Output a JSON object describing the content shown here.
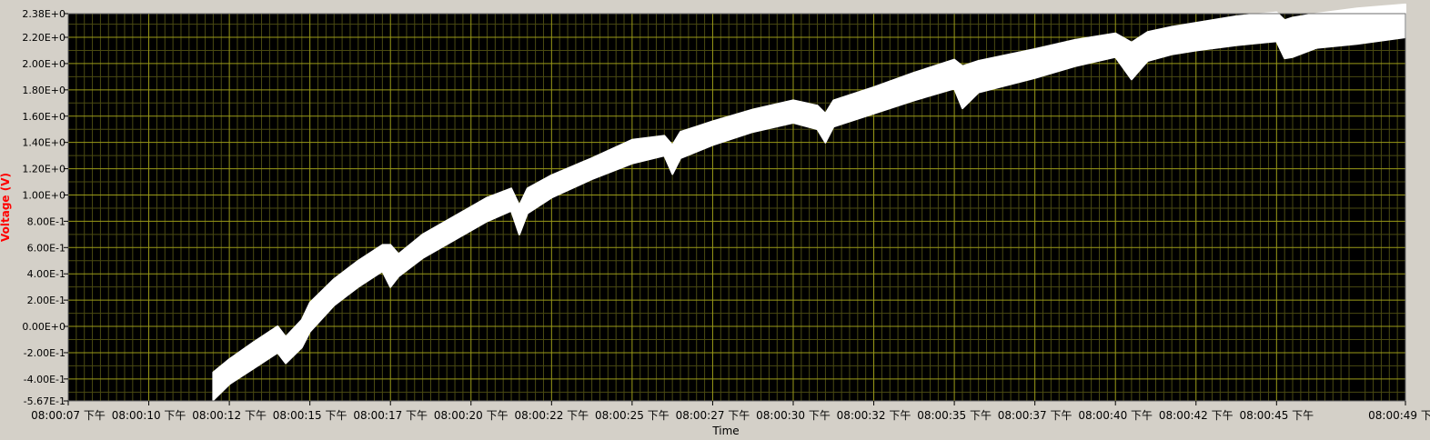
{
  "chart_data": {
    "type": "line",
    "title": "",
    "xlabel": "Time",
    "ylabel": "Voltage (V)",
    "ylim": [
      -0.567,
      2.38
    ],
    "y_ticks": [
      -0.567,
      -0.4,
      -0.2,
      0,
      0.2,
      0.4,
      0.6,
      0.8,
      1.0,
      1.2,
      1.4,
      1.6,
      1.8,
      2.0,
      2.2,
      2.38
    ],
    "y_tick_labels": [
      "-5.67E-1",
      "-4.00E-1",
      "-2.00E-1",
      "0.00E+0",
      "2.00E-1",
      "4.00E-1",
      "6.00E-1",
      "8.00E-1",
      "1.00E+0",
      "1.20E+0",
      "1.40E+0",
      "1.60E+0",
      "1.80E+0",
      "2.00E+0",
      "2.20E+0",
      "2.38E+0"
    ],
    "x_tick_labels": [
      "08:00:07 下午",
      "08:00:10 下午",
      "08:00:12 下午",
      "08:00:15 下午",
      "08:00:17 下午",
      "08:00:20 下午",
      "08:00:22 下午",
      "08:00:25 下午",
      "08:00:27 下午",
      "08:00:30 下午",
      "08:00:32 下午",
      "08:00:35 下午",
      "08:00:37 下午",
      "08:00:40 下午",
      "08:00:42 下午",
      "08:00:45 下午",
      "08:00:49 下午"
    ],
    "xlim": [
      0,
      16.6
    ],
    "x_tick_positions": [
      0,
      1,
      2,
      3,
      4,
      5,
      6,
      7,
      8,
      9,
      10,
      11,
      12,
      13,
      14,
      15,
      16.6
    ],
    "grid": true,
    "colors": {
      "plot_background": "#000000",
      "major_grid": "#9a9a18",
      "minor_grid": "#4a4a12",
      "trace": "#ffffff",
      "axis_label": "#ff0000",
      "frame_background": "#d4d0c8"
    },
    "series": [
      {
        "x": [
          1.8,
          2.0,
          2.3,
          2.6,
          2.7,
          2.9,
          3.0,
          3.3,
          3.6,
          3.9,
          4.0,
          4.1,
          4.4,
          4.8,
          5.2,
          5.5,
          5.6,
          5.7,
          6.0,
          6.5,
          7.0,
          7.4,
          7.5,
          7.6,
          8.0,
          8.5,
          9.0,
          9.3,
          9.4,
          9.5,
          10.0,
          10.5,
          11.0,
          11.1,
          11.3,
          12.0,
          12.5,
          13.0,
          13.2,
          13.4,
          13.7,
          14.0,
          14.5,
          15.0,
          15.1,
          15.2,
          15.5,
          16.0,
          16.6
        ],
        "y_upper": [
          -0.35,
          -0.25,
          -0.12,
          0.0,
          -0.08,
          0.05,
          0.18,
          0.36,
          0.5,
          0.62,
          0.62,
          0.55,
          0.7,
          0.84,
          0.98,
          1.05,
          0.92,
          1.05,
          1.15,
          1.28,
          1.42,
          1.45,
          1.38,
          1.48,
          1.56,
          1.65,
          1.72,
          1.68,
          1.62,
          1.72,
          1.82,
          1.93,
          2.03,
          1.98,
          2.02,
          2.11,
          2.18,
          2.23,
          2.16,
          2.24,
          2.28,
          2.31,
          2.36,
          2.39,
          2.33,
          2.35,
          2.38,
          2.42,
          2.45
        ],
        "y_lower": [
          -0.56,
          -0.44,
          -0.32,
          -0.2,
          -0.28,
          -0.16,
          -0.04,
          0.16,
          0.3,
          0.42,
          0.3,
          0.38,
          0.52,
          0.66,
          0.8,
          0.88,
          0.7,
          0.86,
          0.98,
          1.12,
          1.24,
          1.3,
          1.16,
          1.28,
          1.38,
          1.48,
          1.55,
          1.5,
          1.4,
          1.52,
          1.62,
          1.72,
          1.81,
          1.66,
          1.78,
          1.89,
          1.98,
          2.05,
          1.88,
          2.02,
          2.07,
          2.1,
          2.14,
          2.17,
          2.04,
          2.05,
          2.12,
          2.15,
          2.2
        ]
      }
    ]
  }
}
